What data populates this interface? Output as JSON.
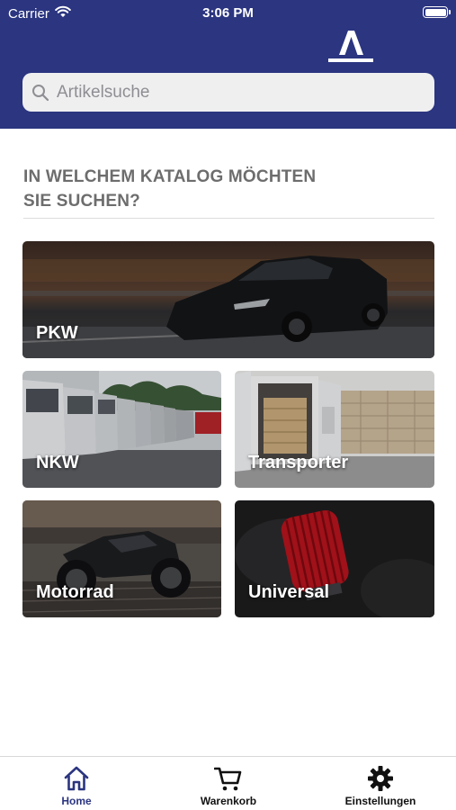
{
  "status_bar": {
    "carrier": "Carrier",
    "time": "3:06 PM"
  },
  "header": {
    "logo_icon": "brand-a-logo"
  },
  "search": {
    "placeholder": "Artikelsuche",
    "value": ""
  },
  "prompt": {
    "line1": "IN WELCHEM KATALOG MÖCHTEN",
    "line2": "SIE SUCHEN?"
  },
  "catalogs": [
    {
      "label": "PKW"
    },
    {
      "label": "NKW"
    },
    {
      "label": "Transporter"
    },
    {
      "label": "Motorrad"
    },
    {
      "label": "Universal"
    }
  ],
  "tabs": [
    {
      "label": "Home",
      "icon": "home-icon",
      "active": true
    },
    {
      "label": "Warenkorb",
      "icon": "cart-icon",
      "active": false
    },
    {
      "label": "Einstellungen",
      "icon": "gear-icon",
      "active": false
    }
  ],
  "colors": {
    "header_bg": "#2b3580",
    "active_tab": "#2b3580",
    "text_gray": "#6d6d6d"
  }
}
